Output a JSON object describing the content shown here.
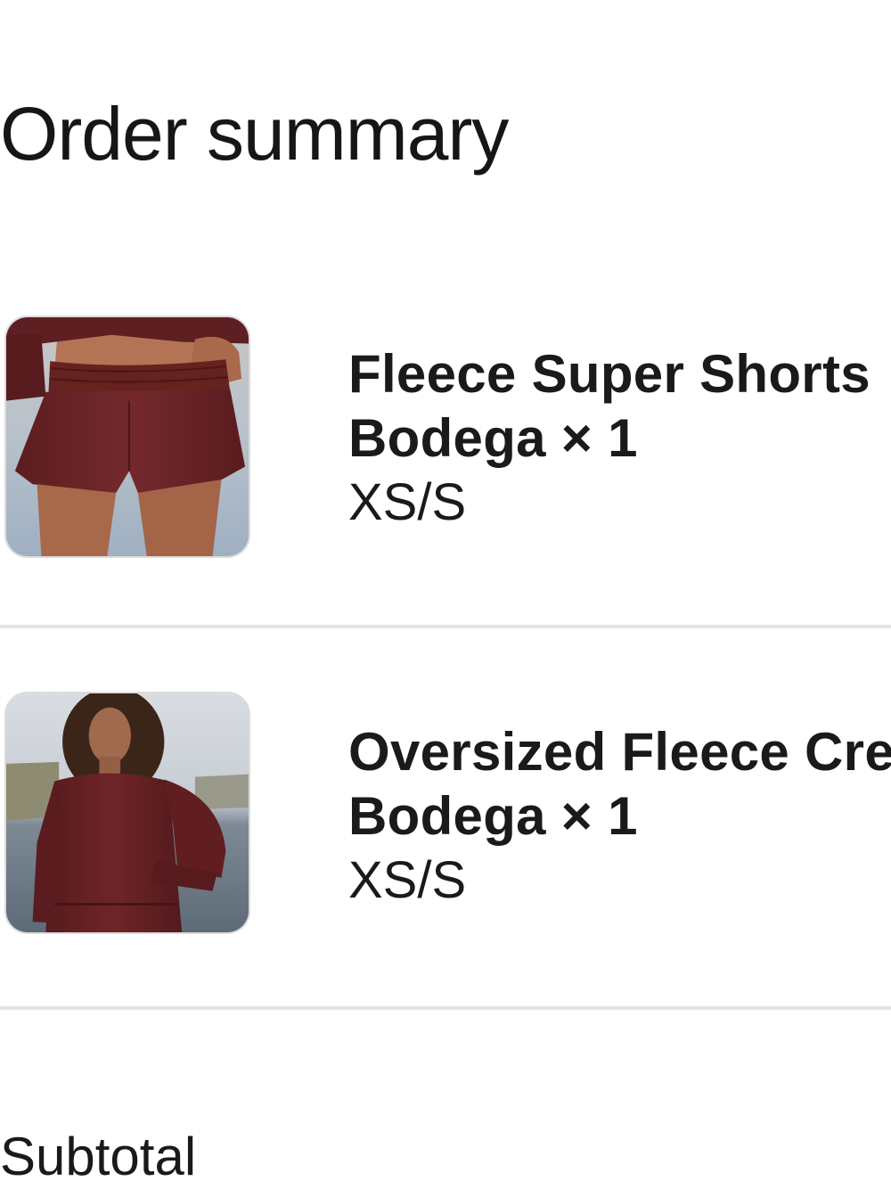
{
  "order_summary": {
    "title": "Order summary",
    "items": [
      {
        "name": "Fleece Super Shorts",
        "variant": "Bodega × 1",
        "size": "XS/S",
        "image": "product-image-shorts"
      },
      {
        "name": "Oversized Fleece Crew",
        "variant": "Bodega × 1",
        "size": "XS/S",
        "image": "product-image-sweatshirt"
      }
    ],
    "subtotal_label": "Subtotal"
  },
  "colors": {
    "product_color": "#6b2326",
    "divider": "#e3e3e3",
    "text": "#1a1a1a"
  }
}
